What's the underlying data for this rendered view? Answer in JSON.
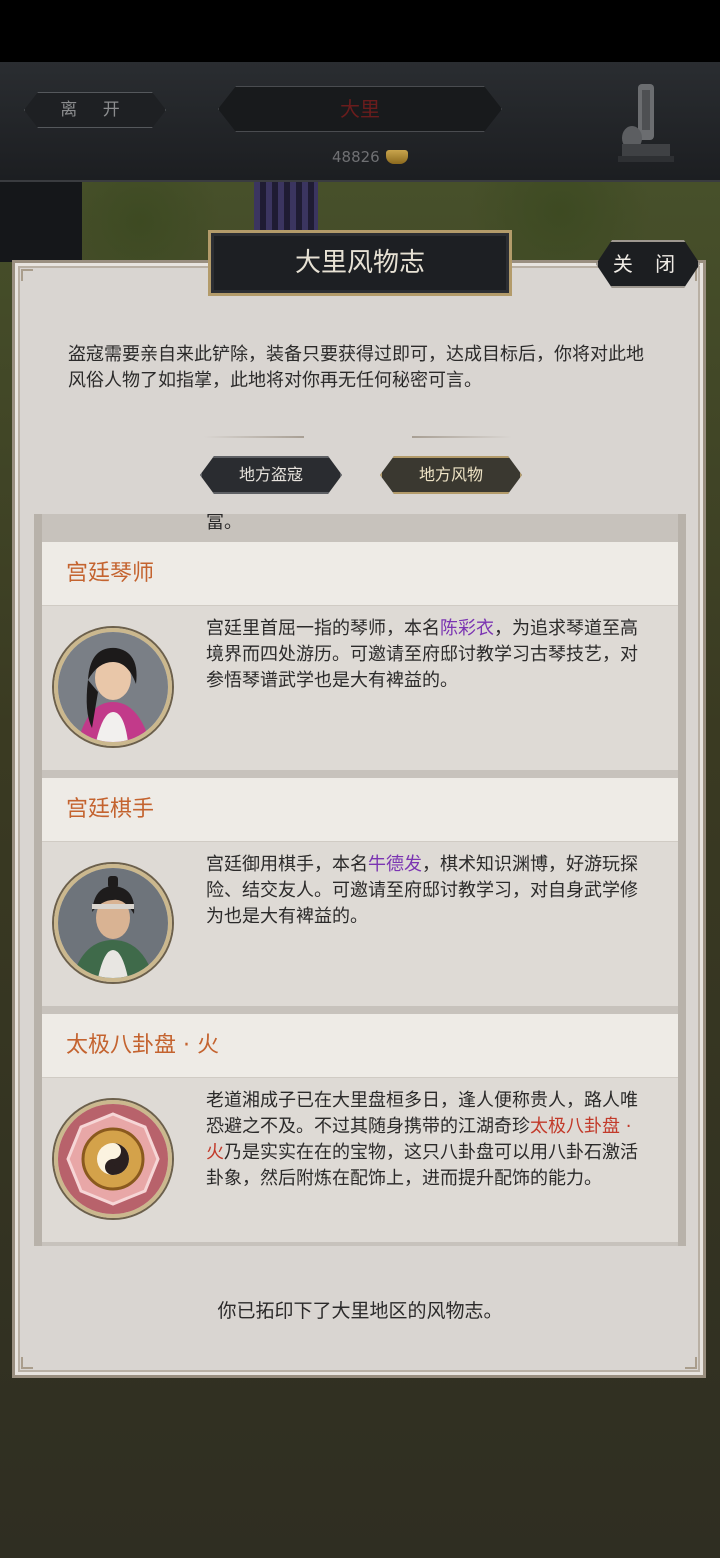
{
  "top_bar": {
    "leave_label": "离 开",
    "city_name": "大里",
    "gold": "48826",
    "gold_icon": "gold-ingot-icon",
    "statue_icon": "stone-lion-statue-icon"
  },
  "dialog": {
    "title": "大里风物志",
    "close_label": "关 闭",
    "intro": "盗寇需要亲自来此铲除，装备只要获得过即可，达成目标后，你将对此地风俗人物了如指掌，此地将对你再无任何秘密可言。",
    "tabs": [
      {
        "label": "地方盗寇",
        "selected": false
      },
      {
        "label": "地方风物",
        "selected": true
      }
    ],
    "cut_text": "富。",
    "entries": [
      {
        "title": "宫廷琴师",
        "desc_pre": "宫廷里首屈一指的琴师，本名",
        "highlight": "陈彩衣",
        "desc_post": "，为追求琴道至高境界而四处游历。可邀请至府邸讨教学习古琴技艺，对参悟琴谱武学也是大有裨益的。",
        "portrait": "female-musician-portrait"
      },
      {
        "title": "宫廷棋手",
        "desc_pre": "宫廷御用棋手，本名",
        "highlight": "牛德发",
        "desc_post": "，棋术知识渊博，好游玩探险、结交友人。可邀请至府邸讨教学习，对自身武学修为也是大有裨益的。",
        "portrait": "male-chess-player-portrait"
      },
      {
        "title": "太极八卦盘 · 火",
        "desc_pre": "老道湘成子已在大里盘桓多日，逢人便称贵人，路人唯恐避之不及。不过其随身携带的江湖奇珍",
        "highlight": "太极八卦盘 · 火",
        "desc_post": "乃是实实在在的宝物，这只八卦盘可以用八卦石激活卦象，然后附炼在配饰上，进而提升配饰的能力。",
        "portrait": "bagua-disc-fire-icon"
      }
    ],
    "footer": "你已拓印下了大里地区的风物志。"
  },
  "colors": {
    "panel": "#d9d5d1",
    "entry_title": "#c4632f",
    "highlight_purple": "#7b35b2",
    "highlight_red": "#c23a2a"
  }
}
